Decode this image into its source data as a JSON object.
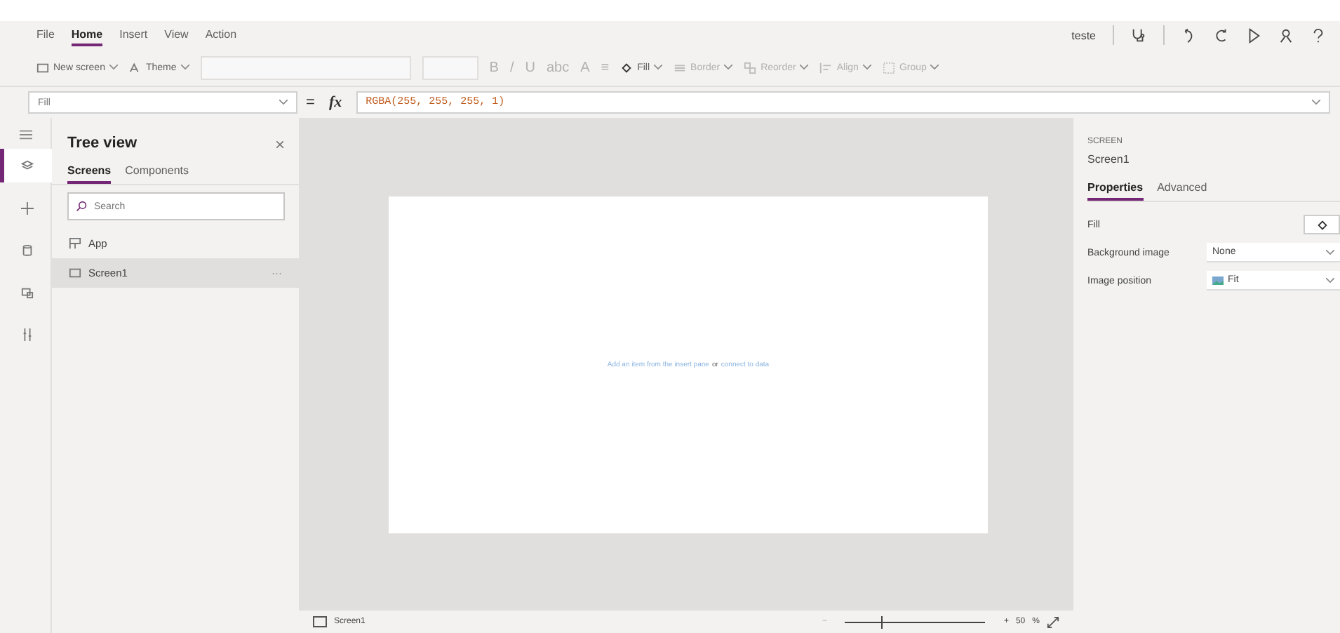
{
  "menu": [
    {
      "label": "File",
      "selected": false
    },
    {
      "label": "Home",
      "selected": true
    },
    {
      "label": "Insert",
      "selected": false
    },
    {
      "label": "View",
      "selected": false
    },
    {
      "label": "Action",
      "selected": false
    }
  ],
  "user": "teste",
  "toolbar": [
    {
      "kind": "button",
      "label": "New screen",
      "disabled": false
    },
    {
      "kind": "button",
      "label": "Theme",
      "disabled": false
    },
    {
      "kind": "dropdown"
    },
    {
      "kind": "dropdown"
    },
    {
      "kind": "glyph",
      "label": "B",
      "disabled": true
    },
    {
      "kind": "glyph",
      "label": "/",
      "disabled": true
    },
    {
      "kind": "glyph",
      "label": "U",
      "disabled": true
    },
    {
      "kind": "glyph",
      "label": "abc",
      "disabled": true
    },
    {
      "kind": "glyph",
      "label": "A",
      "disabled": true
    },
    {
      "kind": "glyph",
      "label": "≡",
      "disabled": true
    },
    {
      "kind": "button",
      "label": "Fill",
      "disabled": false
    },
    {
      "kind": "button",
      "label": "Border",
      "disabled": true
    },
    {
      "kind": "button",
      "label": "Reorder",
      "disabled": true
    },
    {
      "kind": "button",
      "label": "Align",
      "disabled": true
    },
    {
      "kind": "button",
      "label": "Group",
      "disabled": true
    }
  ],
  "formula": {
    "property": "Fill",
    "fx": "fx",
    "equals": "=",
    "value": "RGBA(255, 255, 255, 1)"
  },
  "tree": {
    "title": "Tree view",
    "close": "×",
    "tabs": [
      {
        "label": "Screens",
        "selected": true
      },
      {
        "label": "Components",
        "selected": false
      }
    ],
    "search": {
      "placeholder": "Search"
    },
    "items": [
      {
        "label": "App",
        "selected": false
      },
      {
        "label": "Screen1",
        "selected": true,
        "more": "···"
      }
    ]
  },
  "rail": [
    {
      "selected": true
    },
    {
      "selected": false
    },
    {
      "selected": false
    },
    {
      "selected": false
    },
    {
      "selected": false
    }
  ],
  "canvas": {
    "hint": "Add an item from the insert pane",
    "hint_or": "or",
    "hint_link": "connect to data"
  },
  "statusbar": {
    "screen": "Screen1",
    "minus": "−",
    "plus": "+",
    "zoom": "50",
    "percent": "%",
    "level": 0.26
  },
  "properties": {
    "type": "SCREEN",
    "name": "Screen1",
    "tabs": [
      {
        "label": "Properties",
        "selected": true
      },
      {
        "label": "Advanced",
        "selected": false
      }
    ],
    "rows": [
      {
        "kind": "color",
        "label": "Fill"
      },
      {
        "kind": "select",
        "label": "Background image",
        "value": "None"
      },
      {
        "kind": "image-select",
        "label": "Image position",
        "value": "Fit"
      }
    ]
  }
}
